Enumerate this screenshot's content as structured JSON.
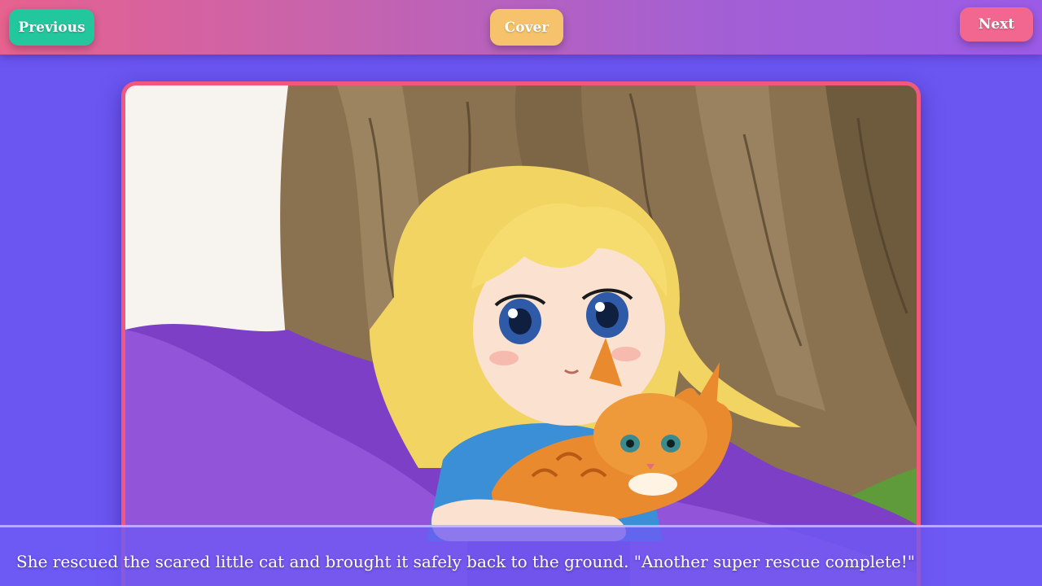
{
  "nav": {
    "previous_label": "Previous",
    "cover_label": "Cover",
    "next_label": "Next"
  },
  "page": {
    "caption": "She rescued the scared little cat and brought it safely back to the ground. \"Another super rescue complete!\""
  },
  "colors": {
    "background": "#6b56f2",
    "previous_button": "#22c79e",
    "cover_button": "#f6c36c",
    "next_button": "#f2678f",
    "frame_border": "#f2577c"
  }
}
